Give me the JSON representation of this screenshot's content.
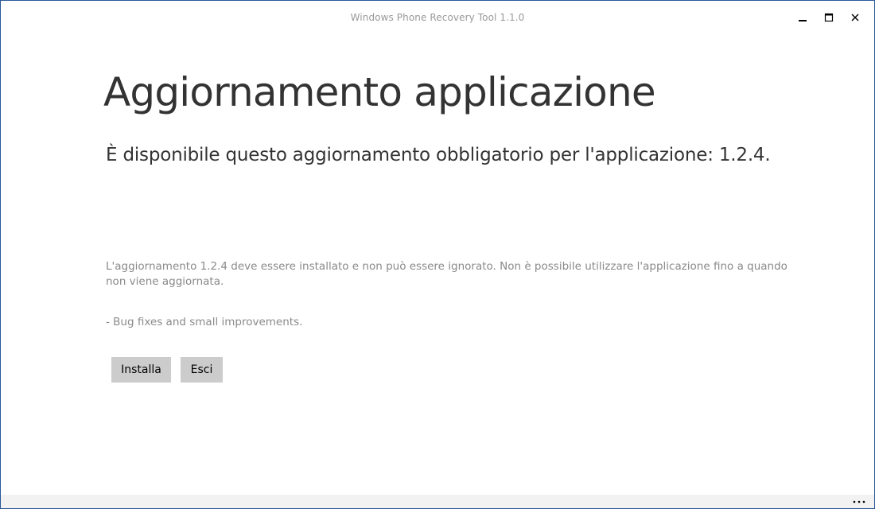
{
  "window": {
    "title": "Windows Phone Recovery Tool 1.1.0",
    "controls": {
      "minimize_icon": "minimize-icon",
      "maximize_icon": "maximize-icon",
      "close_icon": "close-icon"
    }
  },
  "page": {
    "title": "Aggiornamento applicazione",
    "subtitle": "È disponibile questo aggiornamento obbligatorio per l'applicazione: 1.2.4.",
    "description": "L'aggiornamento 1.2.4 deve essere installato e non può essere ignorato. Non è possibile utilizzare l'applicazione fino a quando non viene aggiornata.",
    "release_notes": "- Bug fixes and small improvements."
  },
  "actions": {
    "install_label": "Installa",
    "exit_label": "Esci"
  },
  "appbar": {
    "more_icon": "more-ellipsis-icon"
  },
  "colors": {
    "window_border": "#2b5797",
    "button_bg": "#cccccc",
    "appbar_bg": "#f2f2f2",
    "heading_text": "#333333",
    "secondary_text": "#8a8a8a"
  }
}
